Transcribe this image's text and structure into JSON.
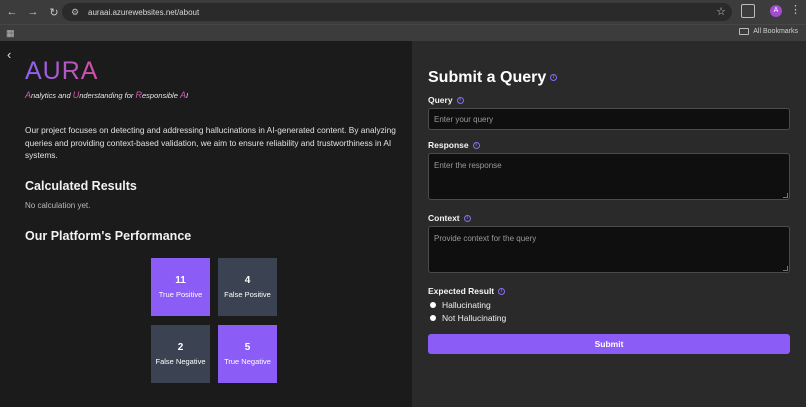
{
  "browser": {
    "url": "auraai.azurewebsites.net/about",
    "all_bookmarks": "All Bookmarks",
    "avatar_letter": "A"
  },
  "brand": {
    "name": "AURA",
    "tagline_parts": [
      {
        "hl": "A",
        "rest": "nalytics and "
      },
      {
        "hl": "U",
        "rest": "nderstanding for "
      },
      {
        "hl": "R",
        "rest": "esponsible "
      },
      {
        "hl": "A",
        "rest": "I"
      }
    ]
  },
  "about_text": "Our project focuses on detecting and addressing hallucinations in AI-generated content. By analyzing queries and providing context-based validation, we aim to ensure reliability and trustworthiness in AI systems.",
  "results": {
    "heading": "Calculated Results",
    "note": "No calculation yet."
  },
  "performance": {
    "heading": "Our Platform's Performance",
    "tiles": [
      {
        "value": "11",
        "label": "True Positive"
      },
      {
        "value": "4",
        "label": "False Positive"
      },
      {
        "value": "2",
        "label": "False Negative"
      },
      {
        "value": "5",
        "label": "True Negative"
      }
    ]
  },
  "form": {
    "title": "Submit a Query",
    "query_label": "Query",
    "query_placeholder": "Enter your query",
    "response_label": "Response",
    "response_placeholder": "Enter the response",
    "context_label": "Context",
    "context_placeholder": "Provide context for the query",
    "expected_label": "Expected Result",
    "options": [
      "Hallucinating",
      "Not Hallucinating"
    ],
    "submit_label": "Submit"
  },
  "colors": {
    "accent": "#8b5cf6",
    "tile_dark": "#3b4353",
    "brand_pink": "#d64fa2"
  }
}
